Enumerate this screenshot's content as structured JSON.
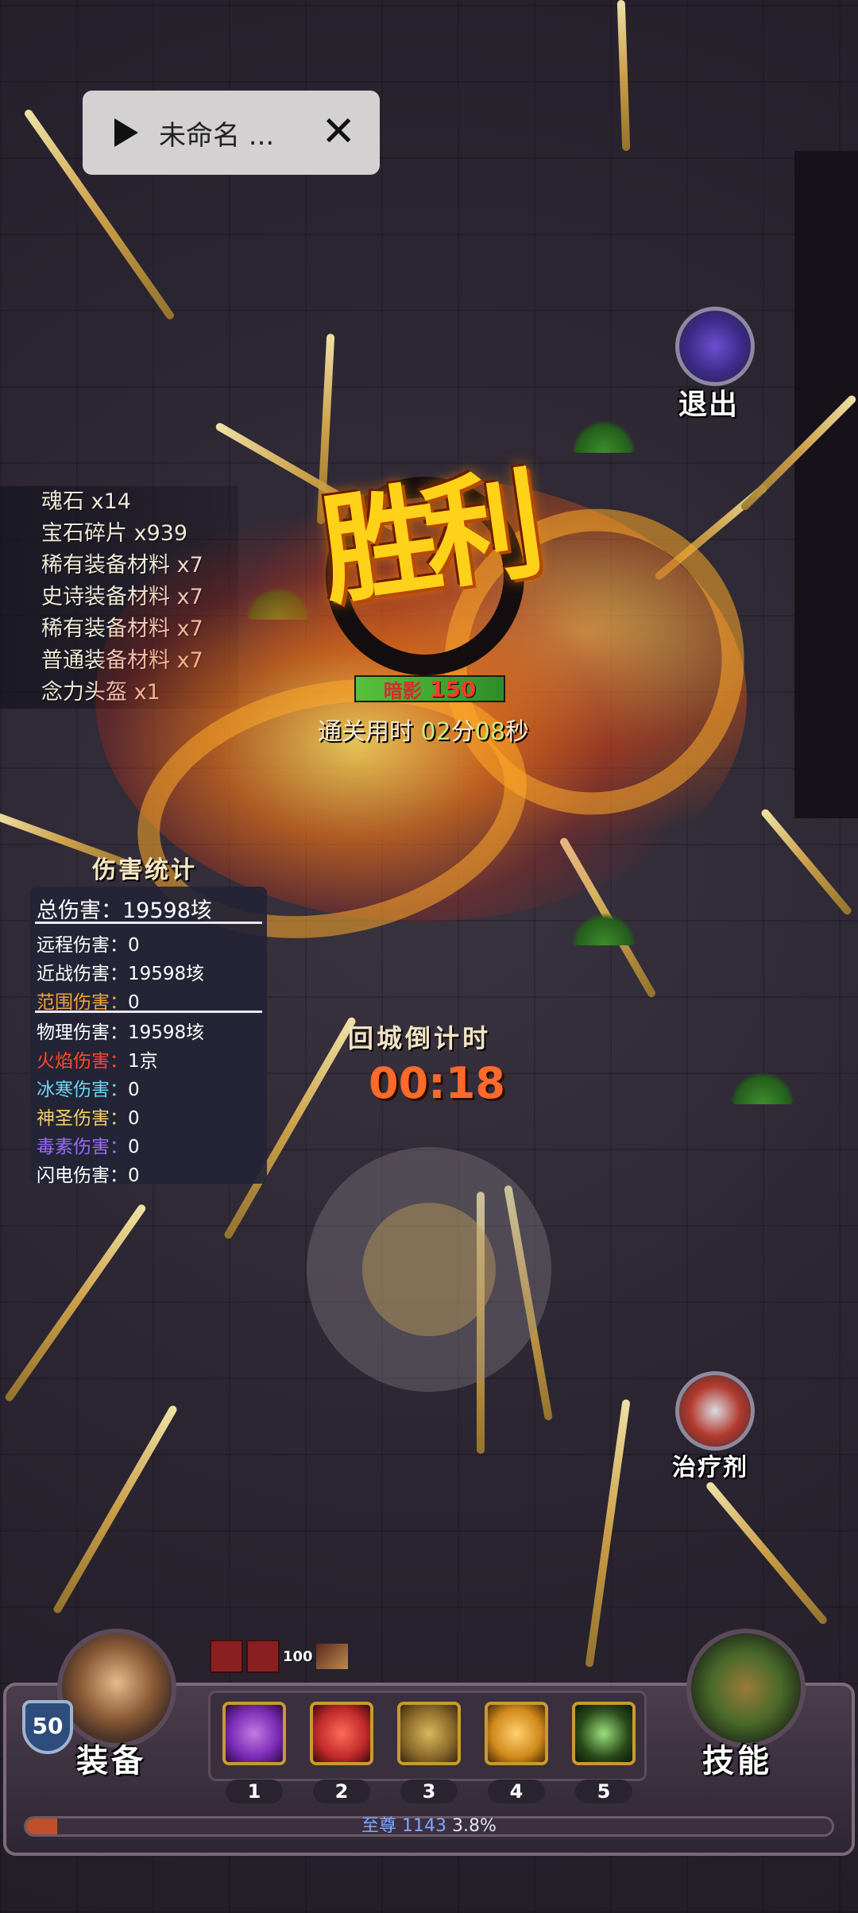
{
  "topbar": {
    "title": "未命名 ...",
    "play_icon": "play-icon",
    "close_icon": "close-icon"
  },
  "exit": {
    "label": "退出",
    "icon": "dungeon-door-icon"
  },
  "potion": {
    "label": "治疗剂",
    "icon": "potion-icon"
  },
  "loot": [
    {
      "name": "魂石",
      "qty": "x14"
    },
    {
      "name": "宝石碎片",
      "qty": "x939"
    },
    {
      "name": "稀有装备材料",
      "qty": "x7"
    },
    {
      "name": "史诗装备材料",
      "qty": "x7"
    },
    {
      "name": "稀有装备材料",
      "qty": "x7"
    },
    {
      "name": "普通装备材料",
      "qty": "x7"
    },
    {
      "name": "念力头盔",
      "qty": "x1"
    }
  ],
  "victory": {
    "title": "胜利",
    "enemy_name": "暗影",
    "enemy_level": "150",
    "clear_time_label": "通关用时",
    "minutes": "02",
    "minutes_unit": "分",
    "seconds": "08",
    "seconds_unit": "秒"
  },
  "damage": {
    "title": "伤害统计",
    "total_label": "总伤害：",
    "total_value": "19598垓",
    "ranged_label": "远程伤害：",
    "ranged_value": "0",
    "melee_label": "近战伤害：",
    "melee_value": "19598垓",
    "area_label": "范围伤害：",
    "area_value": "0",
    "physical_label": "物理伤害：",
    "physical_value": "19598垓",
    "fire_label": "火焰伤害：",
    "fire_value": "1京",
    "ice_label": "冰寒伤害：",
    "ice_value": "0",
    "holy_label": "神圣伤害：",
    "holy_value": "0",
    "poison_label": "毒素伤害：",
    "poison_value": "0",
    "lightning_label": "闪电伤害：",
    "lightning_value": "0",
    "colors": {
      "ranged": "#ffffff",
      "melee": "#ffffff",
      "area": "#f0a53c",
      "fire": "#ff4a2a",
      "ice": "#6ad8f0",
      "holy": "#f2d06a",
      "poison": "#9a6bff",
      "lightning": "#ffffff"
    }
  },
  "countdown": {
    "label": "回城倒计时",
    "time": "00:18"
  },
  "hud": {
    "level": "50",
    "equip_label": "装备",
    "skill_label": "技能",
    "buff_count": "100",
    "skills": [
      {
        "num": "1",
        "icon": "crossed-blades-icon",
        "color": "#7a2ab5"
      },
      {
        "num": "2",
        "icon": "red-slash-icon",
        "color": "#c02a2a"
      },
      {
        "num": "3",
        "icon": "earth-spike-icon",
        "color": "#8a6a2a"
      },
      {
        "num": "4",
        "icon": "golden-wing-icon",
        "color": "#d08a1a"
      },
      {
        "num": "5",
        "icon": "hooded-figure-icon",
        "color": "#2a4a1a"
      }
    ],
    "rank_label": "至尊",
    "rank_value": "1143",
    "progress_text": "3.8%",
    "progress": 0.038
  }
}
